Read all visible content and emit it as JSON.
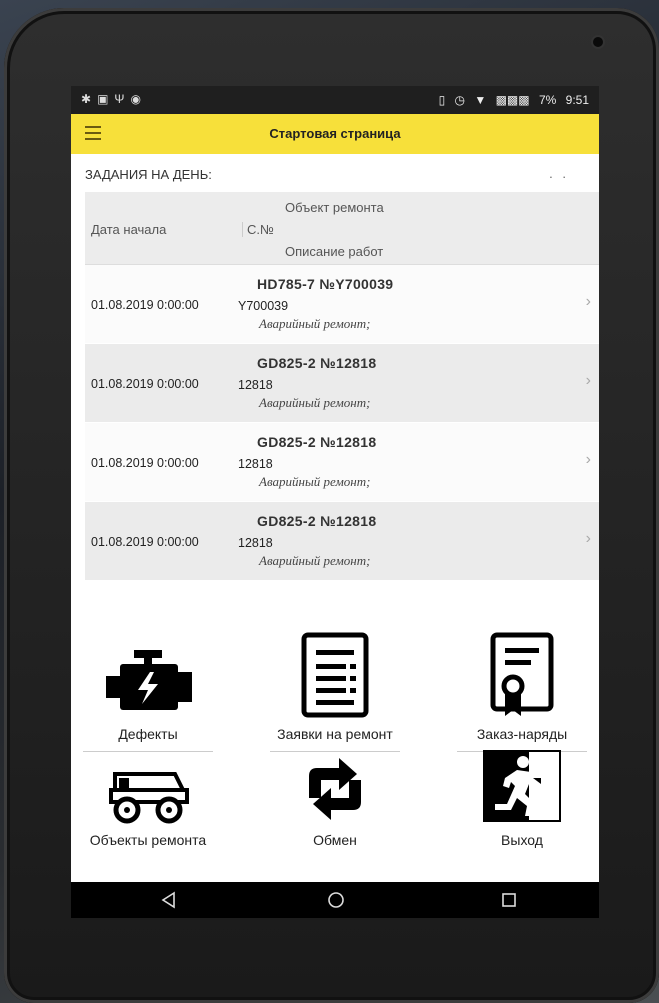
{
  "status_bar": {
    "left_icons": [
      "settings-alert-icon",
      "image-icon",
      "usb-icon",
      "android-icon"
    ],
    "battery": "7%",
    "time": "9:51"
  },
  "app_bar": {
    "title": "Стартовая страница"
  },
  "tasks": {
    "header": "ЗАДАНИЯ НА ДЕНЬ:",
    "more": ". .",
    "columns": {
      "date": "Дата начала",
      "object": "Объект ремонта",
      "serial": "С.№",
      "description": "Описание работ"
    },
    "rows": [
      {
        "date": "01.08.2019 0:00:00",
        "object": "HD785-7 №Y700039",
        "serial": "Y700039",
        "description": "Аварийный ремонт;"
      },
      {
        "date": "01.08.2019 0:00:00",
        "object": "GD825-2 №12818",
        "serial": "12818",
        "description": "Аварийный ремонт;"
      },
      {
        "date": "01.08.2019 0:00:00",
        "object": "GD825-2 №12818",
        "serial": "12818",
        "description": "Аварийный ремонт;"
      },
      {
        "date": "01.08.2019 0:00:00",
        "object": "GD825-2 №12818",
        "serial": "12818",
        "description": "Аварийный ремонт;"
      }
    ]
  },
  "tiles": [
    {
      "label": "Дефекты",
      "icon": "engine-icon"
    },
    {
      "label": "Заявки на ремонт",
      "icon": "document-list-icon"
    },
    {
      "label": "Заказ-наряды",
      "icon": "certificate-icon"
    },
    {
      "label": "Объекты ремонта",
      "icon": "dump-truck-icon"
    },
    {
      "label": "Обмен",
      "icon": "sync-icon"
    },
    {
      "label": "Выход",
      "icon": "exit-icon"
    }
  ],
  "nav": [
    "back-icon",
    "home-icon",
    "recents-icon"
  ],
  "colors": {
    "appbar": "#f7e03a",
    "statusbar": "#1f1f1f"
  }
}
